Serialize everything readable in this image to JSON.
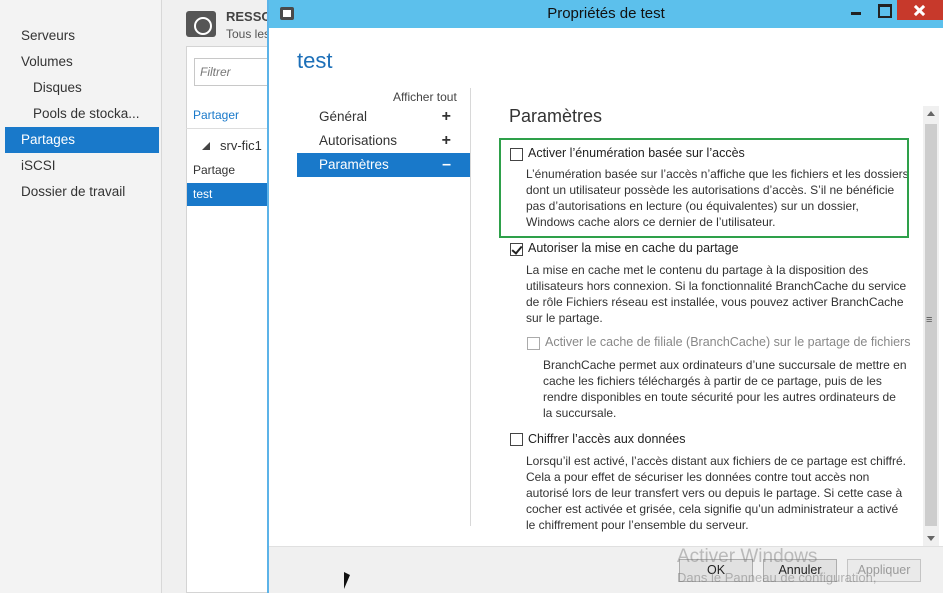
{
  "background": {
    "nav": {
      "items": [
        {
          "label": "Serveurs"
        },
        {
          "label": "Volumes"
        },
        {
          "label": "Disques"
        },
        {
          "label": "Pools de stocka..."
        },
        {
          "label": "Partages"
        },
        {
          "label": "iSCSI"
        },
        {
          "label": "Dossier de travail"
        }
      ]
    },
    "title": "RESSO",
    "subtitle": "Tous les",
    "filter_placeholder": "Filtrer",
    "share_link": "Partager",
    "server": "srv-fic1",
    "column": "Partage",
    "selected_row": "test"
  },
  "dialog": {
    "title": "Propriétés de test",
    "heading": "test",
    "show_all": "Afficher tout",
    "sidebar": [
      {
        "label": "Général",
        "symbol": "+"
      },
      {
        "label": "Autorisations",
        "symbol": "+"
      },
      {
        "label": "Paramètres",
        "symbol": "–"
      }
    ],
    "section_title": "Paramètres",
    "options": {
      "abe": {
        "label": "Activer l’énumération basée sur l’accès",
        "checked": false,
        "desc1": "L’énumération basée sur l’accès n’affiche que les fichiers et les dossiers",
        "desc2": "dont un utilisateur possède les autorisations d’accès. S’il ne bénéficie",
        "desc3": "pas d’autorisations en lecture (ou équivalentes) sur un dossier,",
        "desc4": "Windows cache alors ce dernier de l’utilisateur."
      },
      "cache": {
        "label": "Autoriser la mise en cache du partage",
        "checked": true,
        "desc1": "La mise en cache met le contenu du partage à la disposition des",
        "desc2": "utilisateurs hors connexion. Si la fonctionnalité BranchCache du service",
        "desc3": "de rôle Fichiers réseau est installée, vous pouvez activer BranchCache",
        "desc4": "sur le partage."
      },
      "branchcache": {
        "label": "Activer le cache de filiale (BranchCache) sur le partage de fichiers",
        "checked": false,
        "disabled": true,
        "desc1": "BranchCache permet aux ordinateurs d’une succursale de mettre en",
        "desc2": "cache les fichiers téléchargés à partir de ce partage, puis de les",
        "desc3": "rendre disponibles en toute sécurité pour les autres ordinateurs de",
        "desc4": "la succursale."
      },
      "encrypt": {
        "label": "Chiffrer l’accès aux données",
        "checked": false,
        "desc1": "Lorsqu’il est activé, l’accès distant aux fichiers de ce partage est chiffré.",
        "desc2": "Cela a pour effet de sécuriser les données contre tout accès non",
        "desc3": "autorisé lors de leur transfert vers ou depuis le partage. Si cette case à",
        "desc4": "cocher est activée et grisée, cela signifie qu’un administrateur a activé",
        "desc5": "le chiffrement pour l’ensemble du serveur."
      }
    },
    "buttons": {
      "ok": "OK",
      "cancel": "Annuler",
      "apply": "Appliquer"
    },
    "watermark": {
      "line1": "Activer Windows",
      "line2": "Dans le Panneau de configuration,"
    }
  },
  "colors": {
    "accent": "#1979ca",
    "titlebar": "#5cc0ec",
    "close": "#c7392b",
    "highlight": "#2ea04a",
    "heading": "#1c6fb8"
  }
}
